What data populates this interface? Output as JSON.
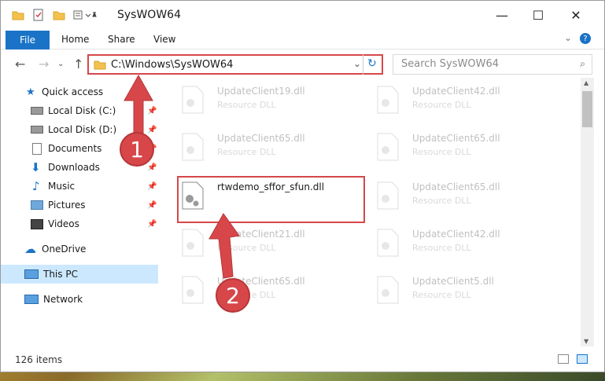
{
  "window": {
    "title": "SysWOW64",
    "controls": {
      "minimize": "—",
      "maximize": "☐",
      "close": "✕"
    }
  },
  "ribbon": {
    "tabs": [
      {
        "label": "File",
        "active": true
      },
      {
        "label": "Home"
      },
      {
        "label": "Share"
      },
      {
        "label": "View"
      }
    ],
    "expand_icon": "chevron-down-icon",
    "help_icon": "help-icon"
  },
  "address": {
    "path": "C:\\Windows\\SysWOW64",
    "search_placeholder": "Search SysWOW64"
  },
  "sidebar": {
    "items": [
      {
        "label": "Quick access",
        "icon": "star-icon",
        "pinned": false
      },
      {
        "label": "Local Disk (C:)",
        "icon": "drive-icon",
        "pinned": true
      },
      {
        "label": "Local Disk (D:)",
        "icon": "drive-icon",
        "pinned": true
      },
      {
        "label": "Documents",
        "icon": "documents-icon",
        "pinned": true
      },
      {
        "label": "Downloads",
        "icon": "downloads-icon",
        "pinned": true
      },
      {
        "label": "Music",
        "icon": "music-icon",
        "pinned": true
      },
      {
        "label": "Pictures",
        "icon": "pictures-icon",
        "pinned": true
      },
      {
        "label": "Videos",
        "icon": "videos-icon",
        "pinned": true
      },
      {
        "label": "OneDrive",
        "icon": "cloud-icon",
        "pinned": false
      },
      {
        "label": "This PC",
        "icon": "computer-icon",
        "pinned": false,
        "selected": true
      },
      {
        "label": "Network",
        "icon": "network-icon",
        "pinned": false
      }
    ]
  },
  "files": {
    "left_column": [
      {
        "name": "UpdateClient19.dll",
        "type": "Resource DLL"
      },
      {
        "name": "UpdateClient65.dll",
        "type": "Resource DLL"
      },
      {
        "name": "rtwdemo_sffor_sfun.dll",
        "type": "",
        "highlighted": true
      },
      {
        "name": "UpdateClient21.dll",
        "type": "Resource DLL"
      },
      {
        "name": "UpdateClient65.dll",
        "type": "Resource DLL"
      }
    ],
    "right_column": [
      {
        "name": "UpdateClient42.dll",
        "type": "Resource DLL"
      },
      {
        "name": "UpdateClient65.dll",
        "type": "Resource DLL"
      },
      {
        "name": "UpdateClient65.dll",
        "type": "Resource DLL"
      },
      {
        "name": "UpdateClient42.dll",
        "type": "Resource DLL"
      },
      {
        "name": "UpdateClient5.dll",
        "type": "Resource DLL"
      }
    ]
  },
  "status": {
    "item_count": "126 items"
  },
  "annotations": {
    "step1": "1",
    "step2": "2",
    "accent_color": "#d7474a"
  }
}
